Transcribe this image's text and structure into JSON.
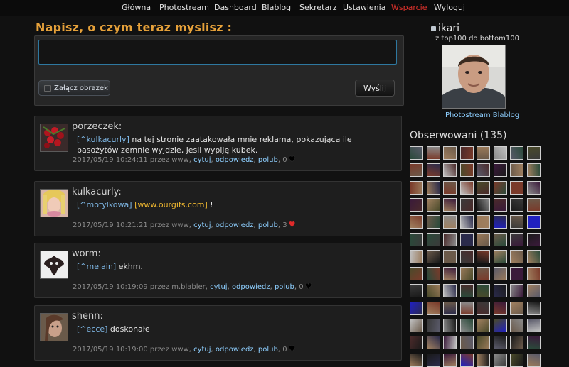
{
  "nav": {
    "items": [
      {
        "label": "Główna",
        "active": false
      },
      {
        "label": "Photostream",
        "active": false
      },
      {
        "label": "Dashboard",
        "active": false
      },
      {
        "label": "Blablog",
        "active": false
      },
      {
        "label": "Sekretarz",
        "active": false
      },
      {
        "label": "Ustawienia",
        "active": false
      },
      {
        "label": "Wsparcie",
        "active": true
      },
      {
        "label": "Wyloguj",
        "active": false
      }
    ]
  },
  "compose": {
    "title": "Napisz, o czym teraz myslisz :",
    "value": "",
    "attach_label": "Załącz obrazek",
    "send_label": "Wyślij"
  },
  "posts": [
    {
      "author": "porzeczek:",
      "mention": "[^kulkacurly]",
      "text": " na tej stronie zaatakowała mnie reklama, pokazująca ile pasożytów zemnie wyjdzie, jesli wypiję kubek.",
      "meta_time": "2017/05/19 10:24:11 przez www, ",
      "actions": [
        "cytuj",
        "odpowiedz",
        "polub"
      ],
      "likes": "0",
      "liked": false
    },
    {
      "author": "kulkacurly:",
      "mention": "[^motylkowa]",
      "link": "[www.ourgifs.com]",
      "text": " !",
      "meta_time": "2017/05/19 10:21:21 przez www, ",
      "actions": [
        "cytuj",
        "odpowiedz",
        "polub"
      ],
      "likes": "3",
      "liked": true
    },
    {
      "author": "worm:",
      "mention": "[^melain]",
      "text": " ekhm.",
      "meta_time": "2017/05/19 10:19:09 przez m.blabler, ",
      "actions": [
        "cytuj",
        "odpowiedz",
        "polub"
      ],
      "likes": "0",
      "liked": false
    },
    {
      "author": "shenn:",
      "mention": "[^ecce]",
      "text": " doskonałe",
      "meta_time": "2017/05/19 10:19:00 przez www, ",
      "actions": [
        "cytuj",
        "odpowiedz",
        "polub"
      ],
      "likes": "0",
      "liked": false
    }
  ],
  "sidebar": {
    "username": "ikari",
    "subtitle": "z top100 do bottom100",
    "link_photostream": "Photostream",
    "link_blablog": "Blablog",
    "following_title": "Obserwowani (135)"
  },
  "colors": {
    "accent": "#e6a13a",
    "link": "#8ecfff",
    "active_nav": "#e0322c",
    "like_red": "#e02a2a"
  },
  "icons": {
    "attach": "image-icon",
    "like": "heart-icon"
  }
}
